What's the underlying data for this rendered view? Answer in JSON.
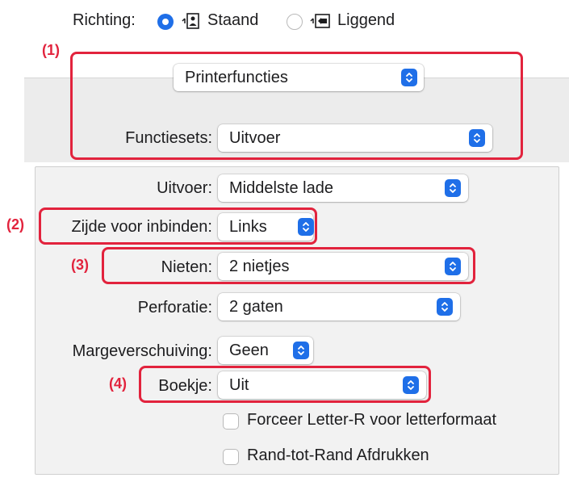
{
  "orientation": {
    "label": "Richting:",
    "options": [
      {
        "label": "Staand",
        "selected": true,
        "icon": "portrait-orientation-icon"
      },
      {
        "label": "Liggend",
        "selected": false,
        "icon": "landscape-orientation-icon"
      }
    ]
  },
  "callouts": {
    "c1": "(1)",
    "c2": "(2)",
    "c3": "(3)",
    "c4": "(4)"
  },
  "section_popup": {
    "value": "Printerfuncties"
  },
  "feature_sets": {
    "label": "Functiesets:",
    "value": "Uitvoer"
  },
  "settings": {
    "output": {
      "label": "Uitvoer:",
      "value": "Middelste lade"
    },
    "binding_edge": {
      "label": "Zijde voor inbinden:",
      "value": "Links"
    },
    "staple": {
      "label": "Nieten:",
      "value": "2 nietjes"
    },
    "punch": {
      "label": "Perforatie:",
      "value": "2 gaten"
    },
    "margin_shift": {
      "label": "Margeverschuiving:",
      "value": "Geen"
    },
    "booklet": {
      "label": "Boekje:",
      "value": "Uit"
    }
  },
  "checkboxes": {
    "force_letter_r": {
      "label": "Forceer Letter-R voor letterformaat",
      "checked": false
    },
    "edge_to_edge": {
      "label": "Rand-tot-Rand Afdrukken",
      "checked": false
    }
  },
  "colors": {
    "accent": "#1f6fe8",
    "callout": "#e2233d"
  }
}
